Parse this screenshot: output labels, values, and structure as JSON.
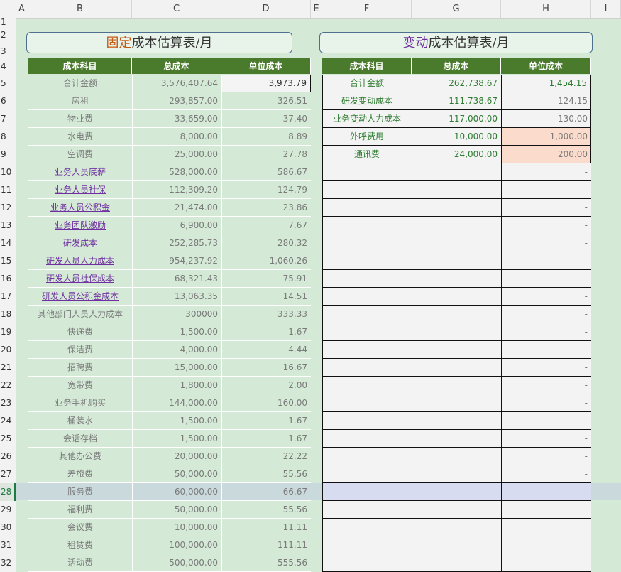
{
  "columns": [
    "A",
    "B",
    "C",
    "D",
    "E",
    "F",
    "G",
    "H",
    "I"
  ],
  "rows": [
    "1",
    "2",
    "3",
    "4",
    "5",
    "6",
    "7",
    "8",
    "9",
    "10",
    "11",
    "12",
    "13",
    "14",
    "15",
    "16",
    "17",
    "18",
    "19",
    "20",
    "21",
    "22",
    "23",
    "24",
    "25",
    "26",
    "27",
    "28",
    "29",
    "30",
    "31",
    "32"
  ],
  "fixed": {
    "title_prefix": "固定",
    "title_rest": "成本估算表/月",
    "headers": [
      "成本科目",
      "总成本",
      "单位成本"
    ],
    "rows": [
      {
        "name": "合计金额",
        "total": "3,576,407.64",
        "unit": "3,973.79",
        "link": false
      },
      {
        "name": "房租",
        "total": "293,857.00",
        "unit": "326.51",
        "link": false
      },
      {
        "name": "物业费",
        "total": "33,659.00",
        "unit": "37.40",
        "link": false
      },
      {
        "name": "水电费",
        "total": "8,000.00",
        "unit": "8.89",
        "link": false
      },
      {
        "name": "空调费",
        "total": "25,000.00",
        "unit": "27.78",
        "link": false
      },
      {
        "name": "业务人员底薪",
        "total": "528,000.00",
        "unit": "586.67",
        "link": true
      },
      {
        "name": "业务人员社保",
        "total": "112,309.20",
        "unit": "124.79",
        "link": true
      },
      {
        "name": "业务人员公积金",
        "total": "21,474.00",
        "unit": "23.86",
        "link": true
      },
      {
        "name": "业务团队激励",
        "total": "6,900.00",
        "unit": "7.67",
        "link": true
      },
      {
        "name": "研发成本",
        "total": "252,285.73",
        "unit": "280.32",
        "link": true
      },
      {
        "name": "研发人员人力成本",
        "total": "954,237.92",
        "unit": "1,060.26",
        "link": true
      },
      {
        "name": "研发人员社保成本",
        "total": "68,321.43",
        "unit": "75.91",
        "link": true
      },
      {
        "name": "研发人员公积金成本",
        "total": "13,063.35",
        "unit": "14.51",
        "link": true
      },
      {
        "name": "其他部门人员人力成本",
        "total": "300000",
        "unit": "333.33",
        "link": false
      },
      {
        "name": "快递费",
        "total": "1,500.00",
        "unit": "1.67",
        "link": false
      },
      {
        "name": "保洁费",
        "total": "4,000.00",
        "unit": "4.44",
        "link": false
      },
      {
        "name": "招聘费",
        "total": "15,000.00",
        "unit": "16.67",
        "link": false
      },
      {
        "name": "宽带费",
        "total": "1,800.00",
        "unit": "2.00",
        "link": false
      },
      {
        "name": "业务手机购买",
        "total": "144,000.00",
        "unit": "160.00",
        "link": false
      },
      {
        "name": "桶装水",
        "total": "1,500.00",
        "unit": "1.67",
        "link": false
      },
      {
        "name": "会话存档",
        "total": "1,500.00",
        "unit": "1.67",
        "link": false
      },
      {
        "name": "其他办公费",
        "total": "20,000.00",
        "unit": "22.22",
        "link": false
      },
      {
        "name": "差旅费",
        "total": "50,000.00",
        "unit": "55.56",
        "link": false
      },
      {
        "name": "服务费",
        "total": "60,000.00",
        "unit": "66.67",
        "link": false
      },
      {
        "name": "福利费",
        "total": "50,000.00",
        "unit": "55.56",
        "link": false
      },
      {
        "name": "会议费",
        "total": "10,000.00",
        "unit": "11.11",
        "link": false
      },
      {
        "name": "租赁费",
        "total": "100,000.00",
        "unit": "111.11",
        "link": false
      },
      {
        "name": "活动费",
        "total": "500,000.00",
        "unit": "555.56",
        "link": false
      }
    ]
  },
  "variable": {
    "title_prefix": "变动",
    "title_rest": "成本估算表/月",
    "headers": [
      "成本科目",
      "总成本",
      "单位成本"
    ],
    "rows": [
      {
        "name": "合计金额",
        "total": "262,738.67",
        "unit": "1,454.15",
        "highlight": false
      },
      {
        "name": "研发变动成本",
        "total": "111,738.67",
        "unit": "124.15",
        "highlight": false
      },
      {
        "name": "业务变动人力成本",
        "total": "117,000.00",
        "unit": "130.00",
        "highlight": false
      },
      {
        "name": "外呼费用",
        "total": "10,000.00",
        "unit": "1,000.00",
        "highlight": true
      },
      {
        "name": "通讯费",
        "total": "24,000.00",
        "unit": "200.00",
        "highlight": true
      }
    ],
    "dash_rows": 18,
    "dash": "-"
  },
  "colors": {
    "header_bg": "#4a7a2c",
    "sheet_bg": "#d4ead7",
    "name_green": "#2e7d32",
    "link_purple": "#7030a0",
    "highlight_peach": "#fbdccc",
    "selected_row": "#c9d9dc",
    "selected_row_right": "#d8dcf0"
  },
  "selected_row": "28"
}
